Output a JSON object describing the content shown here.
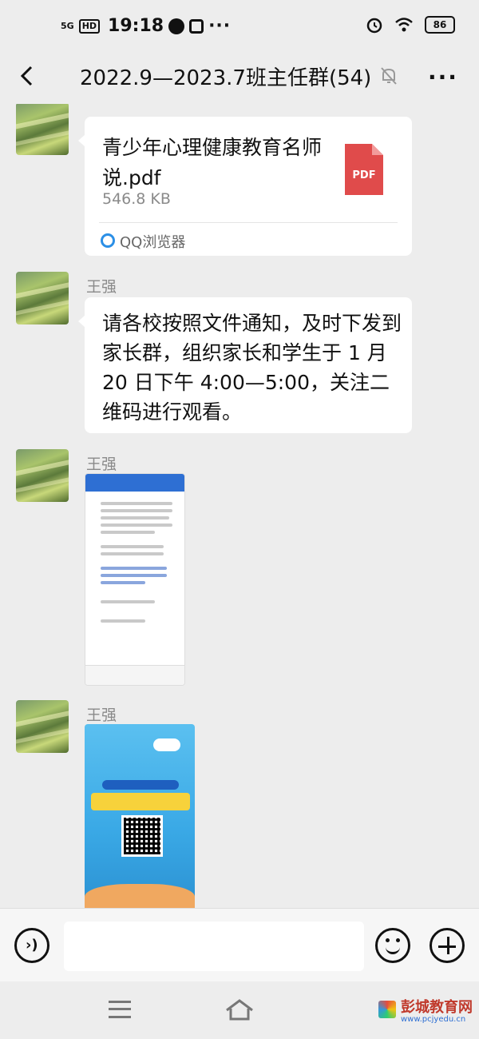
{
  "status_bar": {
    "signal": "5G",
    "hd": "HD",
    "time": "19:18",
    "more": "···",
    "battery": "86"
  },
  "header": {
    "title": "2022.9—2023.7班主任群(54)",
    "menu": "···"
  },
  "messages": [
    {
      "type": "file",
      "file_name": "青少年心理健康教育名师说.pdf",
      "file_size": "546.8 KB",
      "file_type": "PDF",
      "source": "QQ浏览器"
    },
    {
      "type": "text",
      "sender": "王强",
      "text": "请各校按照文件通知，及时下发到家长群，组织家长和学生于 1 月 20 日下午 4:00—5:00，关注二维码进行观看。"
    },
    {
      "type": "image",
      "sender": "王强"
    },
    {
      "type": "image",
      "sender": "王强"
    }
  ],
  "input_bar": {
    "placeholder": ""
  },
  "watermark": {
    "brand": "彭城教育网",
    "url": "www.pcjyedu.cn"
  },
  "icons": [
    "back-icon",
    "mute-bell-icon",
    "more-menu-icon",
    "pdf-icon",
    "qq-browser-icon",
    "voice-icon",
    "emoji-icon",
    "plus-icon",
    "nav-menu-icon",
    "nav-home-icon"
  ]
}
